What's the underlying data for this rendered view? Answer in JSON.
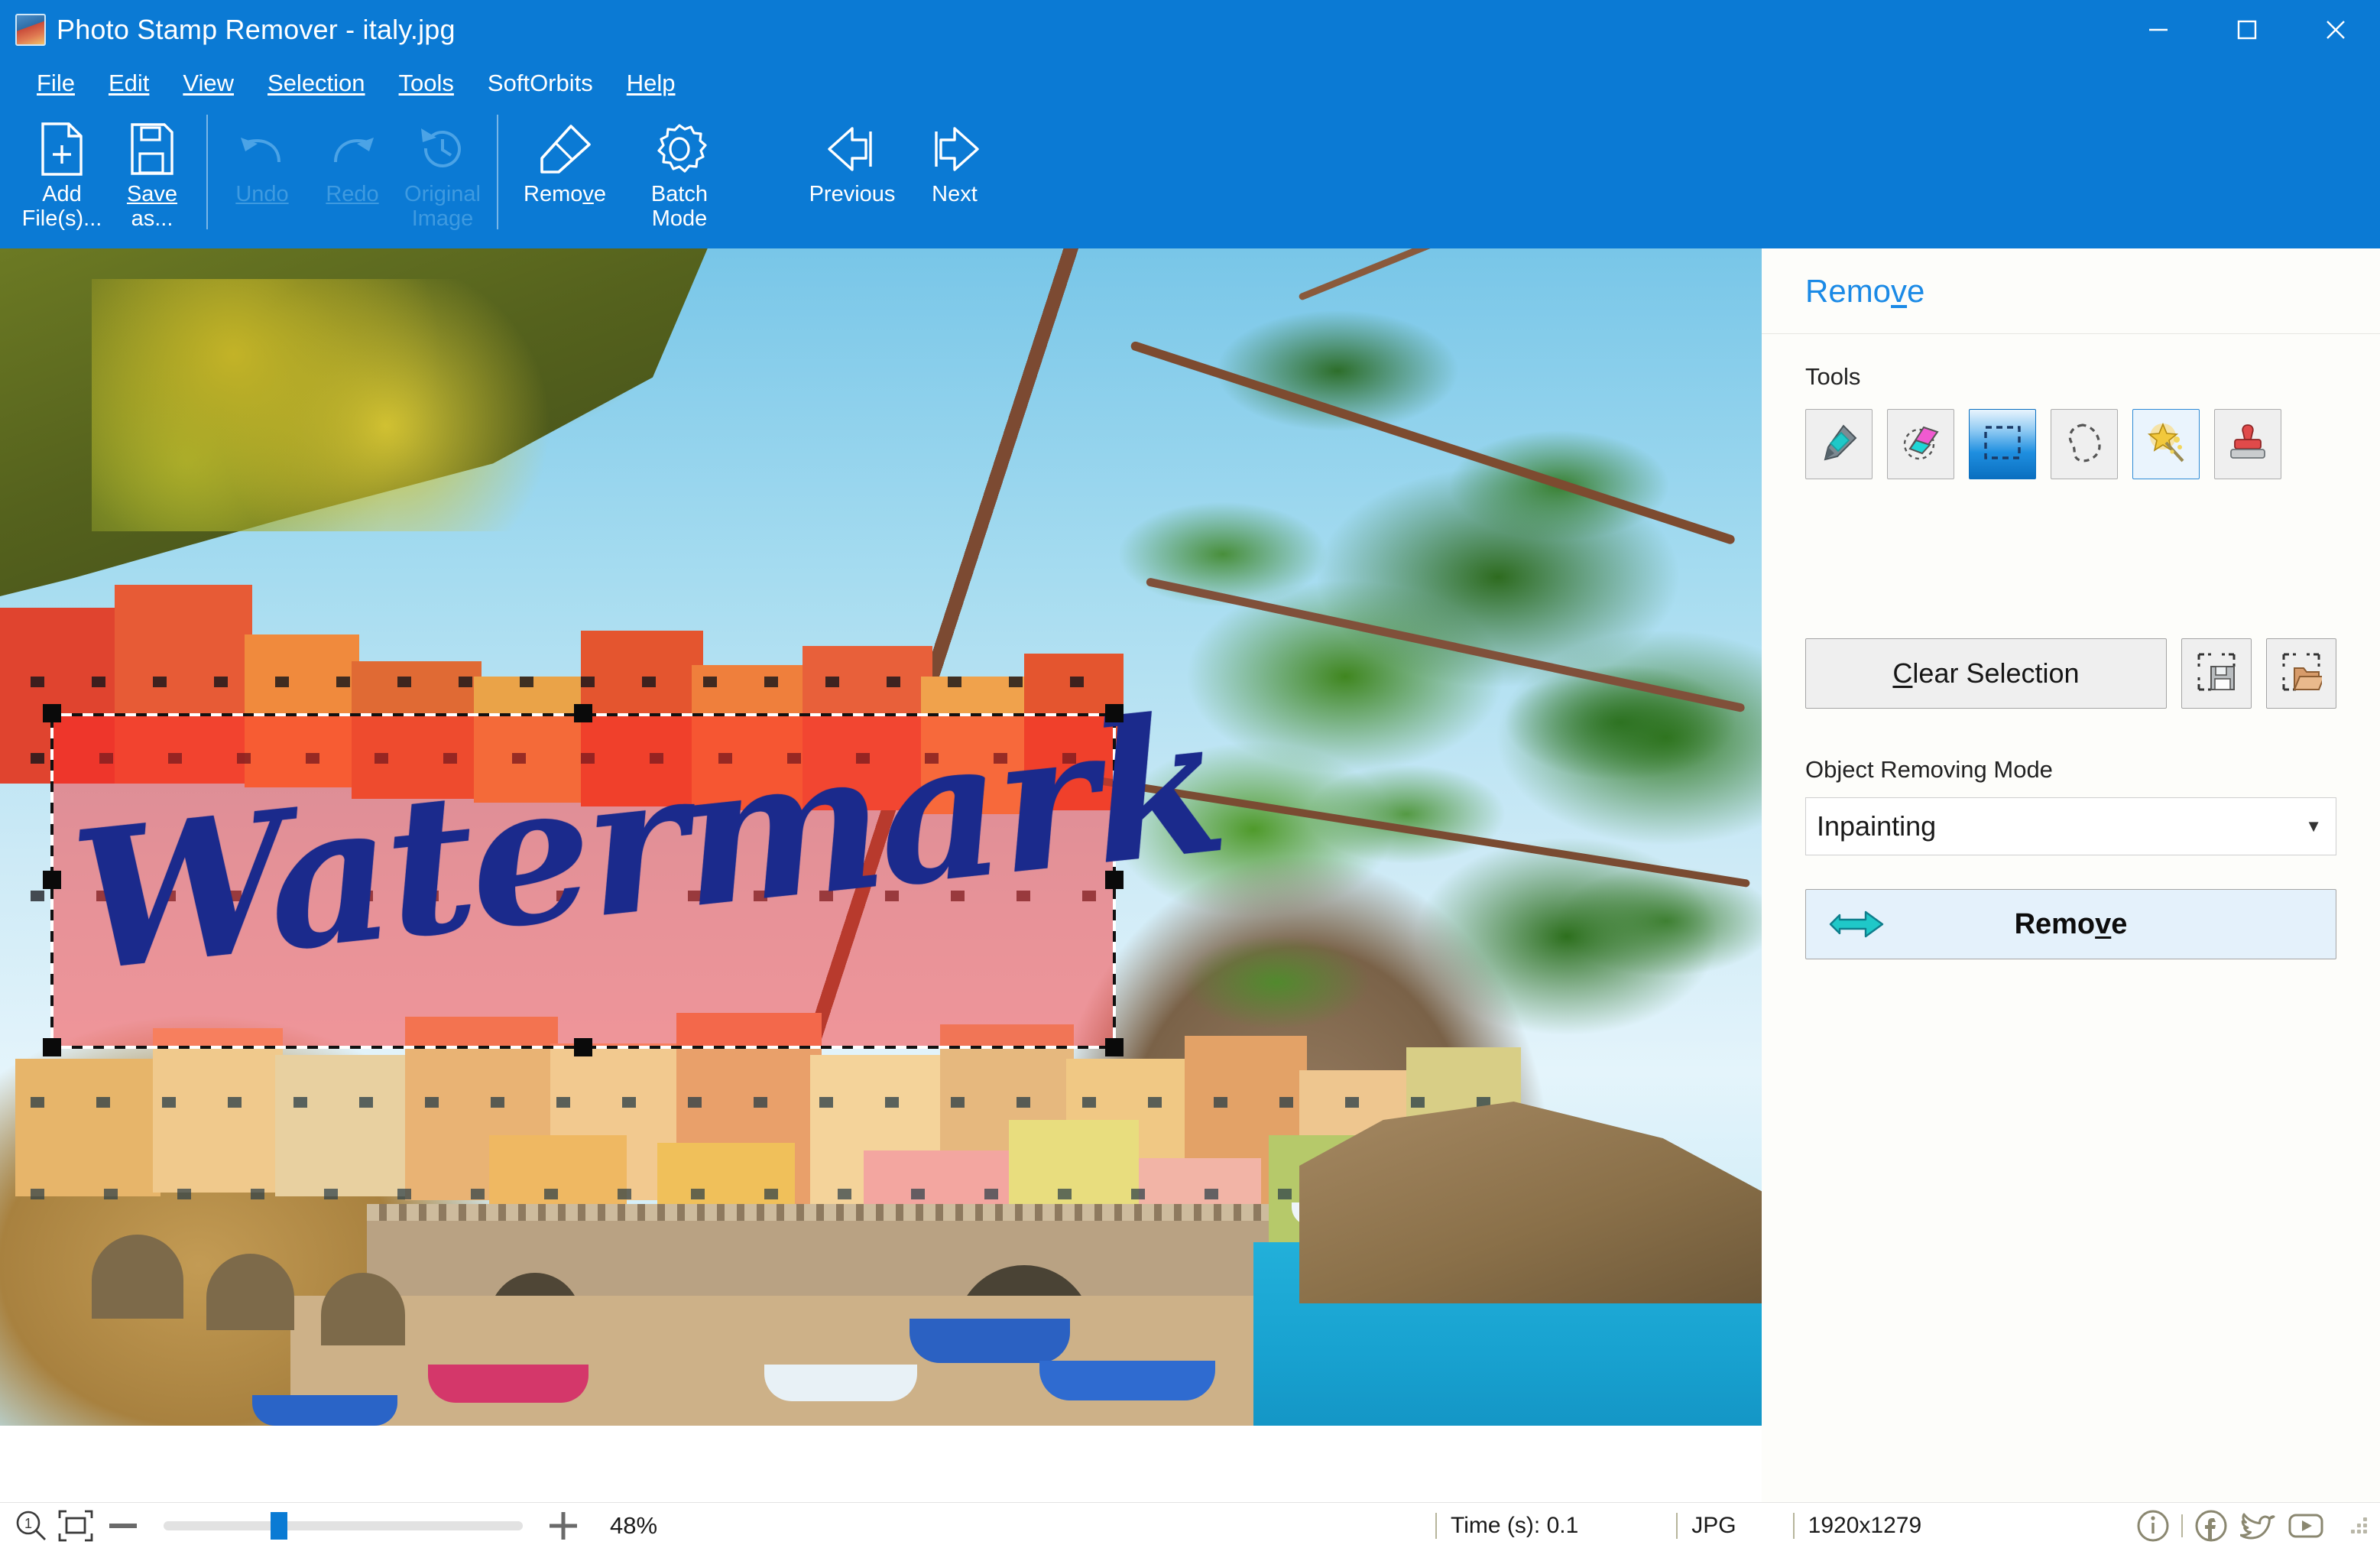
{
  "window": {
    "title": "Photo Stamp Remover - italy.jpg",
    "app_icon": "photo-stamp-remover-icon",
    "controls": {
      "minimize": "minimize-icon",
      "maximize": "maximize-icon",
      "close": "close-icon"
    },
    "accent_color": "#0b7ad4"
  },
  "menubar": {
    "items": [
      {
        "label": "File",
        "accel": "F"
      },
      {
        "label": "Edit",
        "accel": "E"
      },
      {
        "label": "View",
        "accel": "V"
      },
      {
        "label": "Selection",
        "accel": "S"
      },
      {
        "label": "Tools",
        "accel": "T"
      },
      {
        "label": "SoftOrbits",
        "accel": ""
      },
      {
        "label": "Help",
        "accel": "H"
      }
    ]
  },
  "toolbar": {
    "buttons": [
      {
        "label_line1": "Add",
        "label_line2": "File(s)...",
        "icon": "add-file-icon",
        "enabled": true
      },
      {
        "label_line1": "Save",
        "label_line2": "as...",
        "icon": "save-as-icon",
        "enabled": true
      },
      {
        "label_line1": "Undo",
        "label_line2": "",
        "icon": "undo-icon",
        "enabled": false
      },
      {
        "label_line1": "Redo",
        "label_line2": "",
        "icon": "redo-icon",
        "enabled": false
      },
      {
        "label_line1": "Original",
        "label_line2": "Image",
        "icon": "original-image-icon",
        "enabled": false
      },
      {
        "label_line1": "Remove",
        "label_line2": "",
        "icon": "eraser-icon",
        "enabled": true
      },
      {
        "label_line1": "Batch",
        "label_line2": "Mode",
        "icon": "gear-icon",
        "enabled": true
      },
      {
        "label_line1": "Previous",
        "label_line2": "",
        "icon": "arrow-left-icon",
        "enabled": true
      },
      {
        "label_line1": "Next",
        "label_line2": "",
        "icon": "arrow-right-icon",
        "enabled": true
      }
    ]
  },
  "canvas": {
    "image_name": "italy.jpg",
    "description": "Coastal Italian village Manarola with colourful houses on a cliff, pine branches, harbour with boats and turquoise sea",
    "selection": {
      "visible": true,
      "tint_color": "#ff2828",
      "border_style": "marching-ants",
      "handles": 8,
      "watermark_text": "Watermark",
      "watermark_color": "#1b2a8c"
    }
  },
  "panel": {
    "title": "Remove",
    "title_accel": "v",
    "tools_label": "Tools",
    "tools": [
      {
        "name": "marker-tool",
        "icon": "marker-icon",
        "state": "normal"
      },
      {
        "name": "eraser-tool",
        "icon": "eraser-icon",
        "state": "normal"
      },
      {
        "name": "rectangle-select-tool",
        "icon": "rectangle-select-icon",
        "state": "selected"
      },
      {
        "name": "lasso-select-tool",
        "icon": "lasso-icon",
        "state": "normal"
      },
      {
        "name": "magic-wand-tool",
        "icon": "magic-wand-icon",
        "state": "hover"
      },
      {
        "name": "stamp-tool",
        "icon": "stamp-icon",
        "state": "normal"
      }
    ],
    "clear_selection_label": "Clear Selection",
    "clear_selection_accel": "C",
    "save_selection_icon": "save-selection-icon",
    "load_selection_icon": "load-selection-icon",
    "mode_label": "Object Removing Mode",
    "mode_value": "Inpainting",
    "mode_options": [
      "Inpainting"
    ],
    "remove_button_label": "Remove",
    "remove_button_accel": "v",
    "remove_button_icon": "arrow-right-icon"
  },
  "statusbar": {
    "zoom_icon": "zoom-1to1-icon",
    "fit_icon": "fit-to-screen-icon",
    "minus_icon": "minus-icon",
    "plus_icon": "plus-icon",
    "zoom_percent": "48%",
    "time_label": "Time (s): 0.1",
    "format": "JPG",
    "dimensions": "1920x1279",
    "social": [
      {
        "name": "info-icon",
        "label": "i"
      },
      {
        "name": "facebook-icon",
        "label": "f"
      },
      {
        "name": "twitter-icon",
        "label": ""
      },
      {
        "name": "youtube-icon",
        "label": ""
      }
    ]
  }
}
